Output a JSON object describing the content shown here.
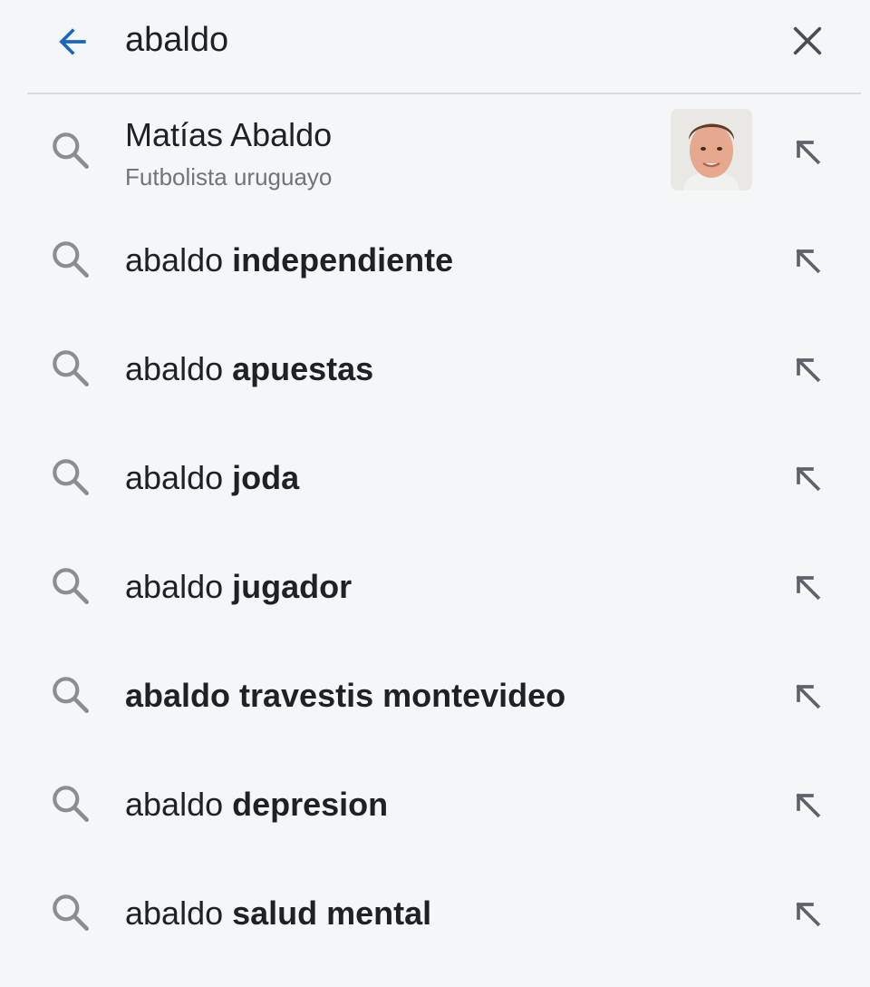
{
  "search": {
    "query": "abaldo",
    "back_icon": "arrow-left-icon",
    "clear_icon": "close-icon",
    "accent_color": "#1a66b8"
  },
  "suggestions": {
    "entity": {
      "title": "Matías Abaldo",
      "subtitle": "Futbolista uruguayo",
      "thumbnail": "person-photo"
    },
    "items": [
      {
        "query": "abaldo",
        "completion": "independiente"
      },
      {
        "query": "abaldo",
        "completion": "apuestas"
      },
      {
        "query": "abaldo",
        "completion": "joda"
      },
      {
        "query": "abaldo",
        "completion": "jugador"
      },
      {
        "query": "",
        "completion": "abaldo travestis montevideo"
      },
      {
        "query": "abaldo",
        "completion": "depresion"
      },
      {
        "query": "abaldo",
        "completion": "salud mental"
      }
    ],
    "row_icon": "search-icon",
    "fill_icon": "arrow-up-left-icon"
  }
}
